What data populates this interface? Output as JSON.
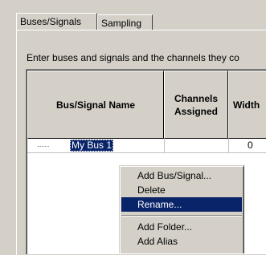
{
  "tabs": [
    {
      "label": "Buses/Signals"
    },
    {
      "label": "Sampling"
    }
  ],
  "instructions": "Enter buses and signals and the channels they co",
  "table": {
    "headers": {
      "name": "Bus/Signal Name",
      "channels": "Channels Assigned",
      "width": "Width"
    },
    "rows": [
      {
        "name": "My Bus 1",
        "width": "0"
      }
    ]
  },
  "context_menu": {
    "items": [
      {
        "label": "Add Bus/Signal..."
      },
      {
        "label": "Delete"
      },
      {
        "label": "Rename..."
      },
      {
        "label": "Add Folder..."
      },
      {
        "label": "Add Alias"
      }
    ],
    "active_item": "Rename..."
  }
}
